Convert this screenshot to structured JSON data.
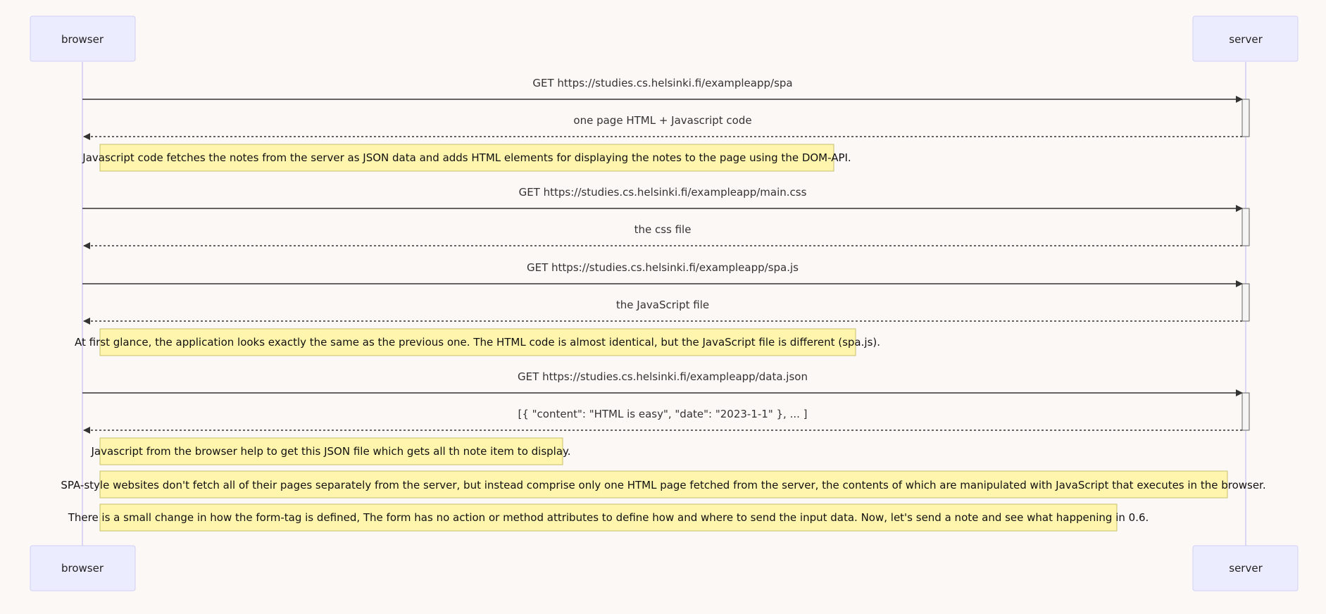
{
  "participants": {
    "browser": "browser",
    "server": "server"
  },
  "messages": [
    {
      "label": "GET https://studies.cs.helsinki.fi/exampleapp/spa",
      "from": "browser",
      "to": "server",
      "style": "solid"
    },
    {
      "label": "one page HTML + Javascript code",
      "from": "server",
      "to": "browser",
      "style": "dotted"
    },
    {
      "label": "GET https://studies.cs.helsinki.fi/exampleapp/main.css",
      "from": "browser",
      "to": "server",
      "style": "solid"
    },
    {
      "label": "the css file",
      "from": "server",
      "to": "browser",
      "style": "dotted"
    },
    {
      "label": "GET https://studies.cs.helsinki.fi/exampleapp/spa.js",
      "from": "browser",
      "to": "server",
      "style": "solid"
    },
    {
      "label": "the JavaScript file",
      "from": "server",
      "to": "browser",
      "style": "dotted"
    },
    {
      "label": "GET https://studies.cs.helsinki.fi/exampleapp/data.json",
      "from": "browser",
      "to": "server",
      "style": "solid"
    },
    {
      "label": "[{ \"content\": \"HTML is easy\", \"date\": \"2023-1-1\" }, ... ]",
      "from": "server",
      "to": "browser",
      "style": "dotted"
    }
  ],
  "notes": [
    {
      "text": "Javascript code fetches the notes from the server as JSON data and adds HTML elements for displaying the notes to the page using the DOM-API."
    },
    {
      "text": "At first glance, the application looks exactly the same as the previous one. The HTML code is almost identical, but the JavaScript file is different (spa.js)."
    },
    {
      "text": "Javascript from the browser help to get this JSON file which gets all th note item to display."
    },
    {
      "text": "SPA-style websites don't fetch all of their pages separately from the server, but instead comprise only one HTML page fetched from the server, the contents of which are manipulated with JavaScript that executes in the browser."
    },
    {
      "text": "There is a small change in how the form-tag is defined, The form has no action or method attributes to define how and where to send the input data. Now, let's send a note and see what happening in 0.6."
    }
  ],
  "colors": {
    "background": "#fcf8f5",
    "actor_fill": "#ececff",
    "actor_stroke": "#cfcff5",
    "lifeline": "#d3cdf5",
    "note_fill": "#fff5ad",
    "note_stroke": "#c8c070",
    "line": "#333333"
  }
}
